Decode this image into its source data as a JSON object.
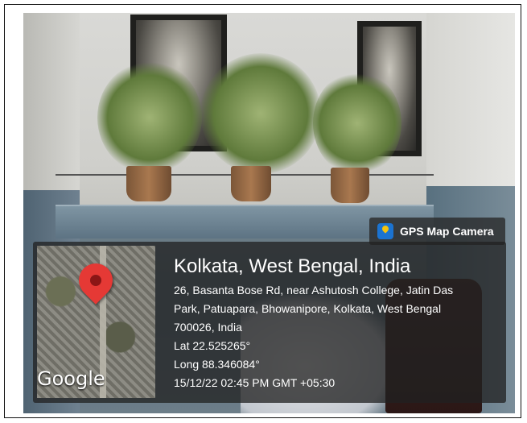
{
  "badge": {
    "label": "GPS Map Camera",
    "icon": "map-pin-icon"
  },
  "map": {
    "logo": "Google",
    "marker_color": "#e53935"
  },
  "location": {
    "title": "Kolkata, West Bengal, India",
    "address_lines": [
      "26, Basanta Bose Rd, near Ashutosh College, Jatin Das",
      "Park, Patuapara, Bhowanipore, Kolkata, West Bengal",
      "700026, India"
    ],
    "lat": "Lat 22.525265°",
    "long": "Long 88.346084°",
    "timestamp": "15/12/22 02:45 PM GMT +05:30"
  }
}
